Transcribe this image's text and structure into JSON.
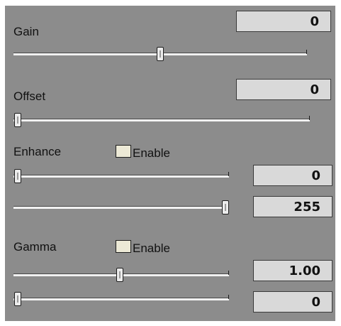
{
  "gain": {
    "label": "Gain",
    "value": "0"
  },
  "offset": {
    "label": "Offset",
    "value": "0"
  },
  "enhance": {
    "label": "Enhance",
    "enable_label": "Enable",
    "low_value": "0",
    "high_value": "255"
  },
  "gamma": {
    "label": "Gamma",
    "enable_label": "Enable",
    "value": "1.00",
    "second_value": "0"
  },
  "colors": {
    "panel": "#8c8c8c",
    "value_box": "#d9d9d9",
    "checkbox": "#ece9d6"
  }
}
